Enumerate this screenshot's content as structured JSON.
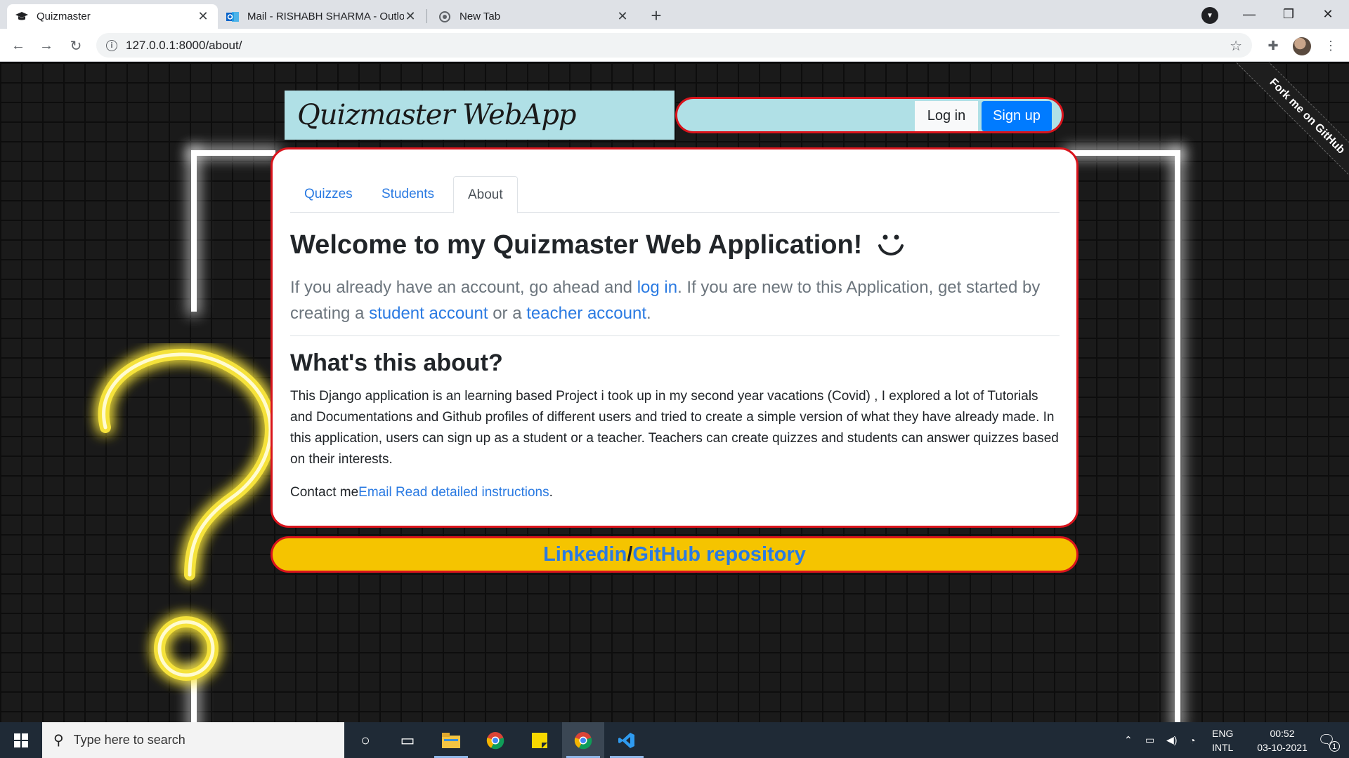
{
  "browser": {
    "tabs": [
      {
        "title": "Quizmaster",
        "icon": "graduation-cap-icon",
        "active": true
      },
      {
        "title": "Mail - RISHABH SHARMA - Outlo",
        "icon": "outlook-icon",
        "active": false
      },
      {
        "title": "New Tab",
        "icon": "chrome-icon",
        "active": false
      }
    ],
    "url": "127.0.0.1:8000/about/"
  },
  "page": {
    "logo": "Quizmaster WebApp",
    "login_label": "Log in",
    "signup_label": "Sign up",
    "fork_ribbon": "Fork me on GitHub",
    "nav_tabs": [
      {
        "label": "Quizzes",
        "active": false
      },
      {
        "label": "Students",
        "active": false
      },
      {
        "label": "About",
        "active": true
      }
    ],
    "welcome_title": "Welcome to my Quizmaster Web Application!",
    "lead": {
      "part1": "If you already have an account, go ahead and ",
      "login_link": "log in",
      "part2": ". If you are new to this Application, get started by creating a ",
      "student_link": "student account",
      "part3": " or a ",
      "teacher_link": "teacher account",
      "part4": "."
    },
    "about_heading": "What's this about?",
    "about_body": "This Django application is an learning based Project i took up in my second year vacations (Covid) , I explored a lot of Tutorials and Documentations and Github profiles of different users and tried to create a simple version of what they have already made. In this application, users can sign up as a student or a teacher. Teachers can create quizzes and students can answer quizzes based on their interests.",
    "contact": {
      "prefix": "Contact me",
      "email_link": "Email",
      "instructions_link": "Read detailed instructions",
      "suffix": "."
    },
    "footer": {
      "linkedin": "Linkedin",
      "separator": " /",
      "github": "GitHub repository"
    }
  },
  "taskbar": {
    "search_placeholder": "Type here to search",
    "lang_top": "ENG",
    "lang_bottom": "INTL",
    "time": "00:52",
    "date": "03-10-2021",
    "notification_count": "1"
  },
  "colors": {
    "accent_red": "#d9141c",
    "link_blue": "#2a7ae2",
    "signup_blue": "#007bff",
    "logo_bg": "#b0e0e6",
    "footer_yellow": "#f5c400"
  }
}
